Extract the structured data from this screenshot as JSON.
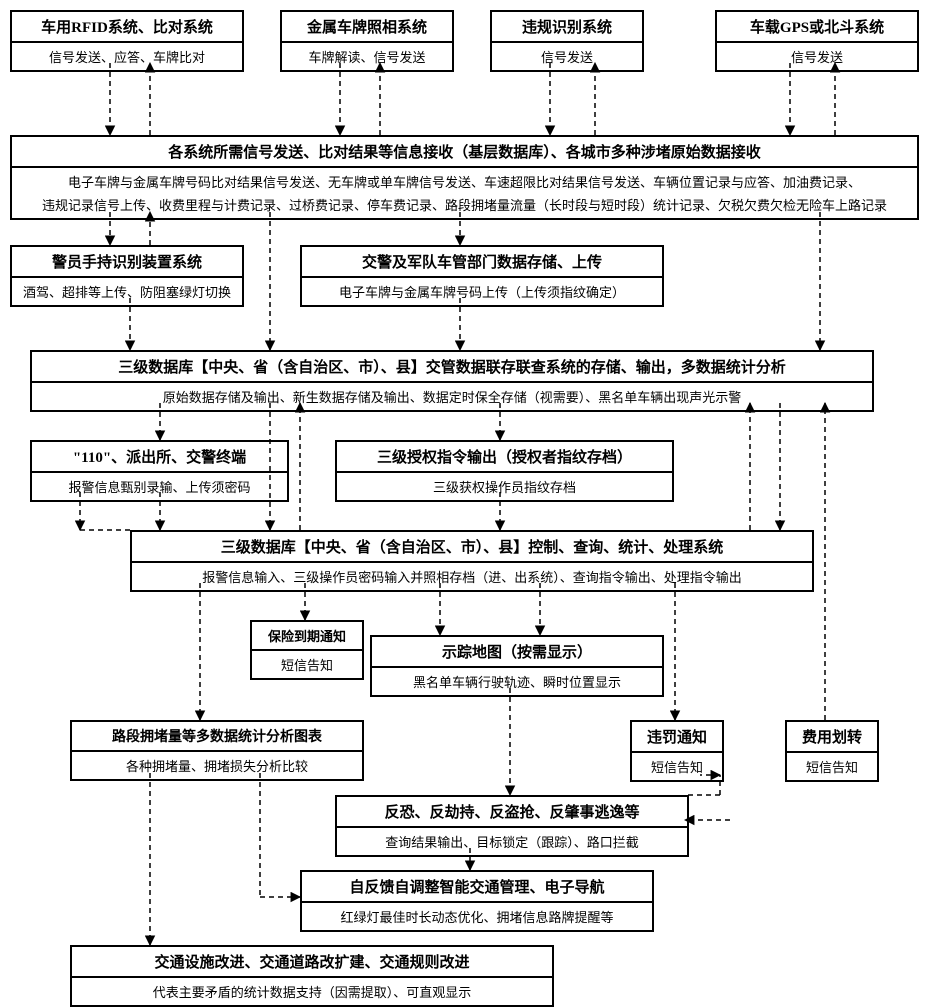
{
  "r1": {
    "rfid": {
      "title": "车用RFID系统、比对系统",
      "sub": "信号发送、应答、车牌比对"
    },
    "plate": {
      "title": "金属车牌照相系统",
      "sub": "车牌解读、信号发送"
    },
    "violation": {
      "title": "违规识别系统",
      "sub": "信号发送"
    },
    "gps": {
      "title": "车载GPS或北斗系统",
      "sub": "信号发送"
    }
  },
  "signalHub": {
    "title": "各系统所需信号发送、比对结果等信息接收（基层数据库）、各城市多种涉堵原始数据接收",
    "line1": "电子车牌与金属车牌号码比对结果信号发送、无车牌或单车牌信号发送、车速超限比对结果信号发送、车辆位置记录与应答、加油费记录、",
    "line2": "违规记录信号上传、收费里程与计费记录、过桥费记录、停车费记录、路段拥堵量流量（长时段与短时段）统计记录、欠税欠费欠检无险车上路记录"
  },
  "r2": {
    "police": {
      "title": "警员手持识别装置系统",
      "sub": "酒驾、超排等上传、防阻塞绿灯切换"
    },
    "army": {
      "title": "交警及军队车管部门数据存储、上传",
      "sub": "电子车牌与金属车牌号码上传（上传须指纹确定）"
    }
  },
  "db3": {
    "title": "三级数据库【中央、省（含自治区、市）、县】交管数据联存联查系统的存储、输出，多数据统计分析",
    "sub": "原始数据存储及输出、新生数据存储及输出、数据定时保全存储（视需要）、黑名单车辆出现声光示警"
  },
  "r3": {
    "police110": {
      "title": "\"110\"、派出所、交警终端",
      "sub": "报警信息甄别录输、上传须密码"
    },
    "auth": {
      "title": "三级授权指令输出（授权者指纹存档）",
      "sub": "三级获权操作员指纹存档"
    }
  },
  "ctrl": {
    "title": "三级数据库【中央、省（含自治区、市）、县】控制、查询、统计、处理系统",
    "sub": "报警信息输入、三级操作员密码输入并照相存档（进、出系统）、查询指令输出、处理指令输出"
  },
  "insurance": {
    "title": "保险到期通知",
    "sub": "短信告知"
  },
  "map": {
    "title": "示踪地图（按需显示）",
    "sub": "黑名单车辆行驶轨迹、瞬时位置显示"
  },
  "r4": {
    "jam": {
      "title": "路段拥堵量等多数据统计分析图表",
      "sub": "各种拥堵量、拥堵损失分析比较"
    },
    "penalty": {
      "title": "违罚通知",
      "sub": "短信告知"
    },
    "fee": {
      "title": "费用划转",
      "sub": "短信告知"
    }
  },
  "anti": {
    "title": "反恐、反劫持、反盗抢、反肇事逃逸等",
    "sub": "查询结果输出、目标锁定（跟踪）、路口拦截"
  },
  "smart": {
    "title": "自反馈自调整智能交通管理、电子导航",
    "sub": "红绿灯最佳时长动态优化、拥堵信息路牌提醒等"
  },
  "infra": {
    "title": "交通设施改进、交通道路改扩建、交通规则改进",
    "sub": "代表主要矛盾的统计数据支持（因需提取）、可直观显示"
  }
}
